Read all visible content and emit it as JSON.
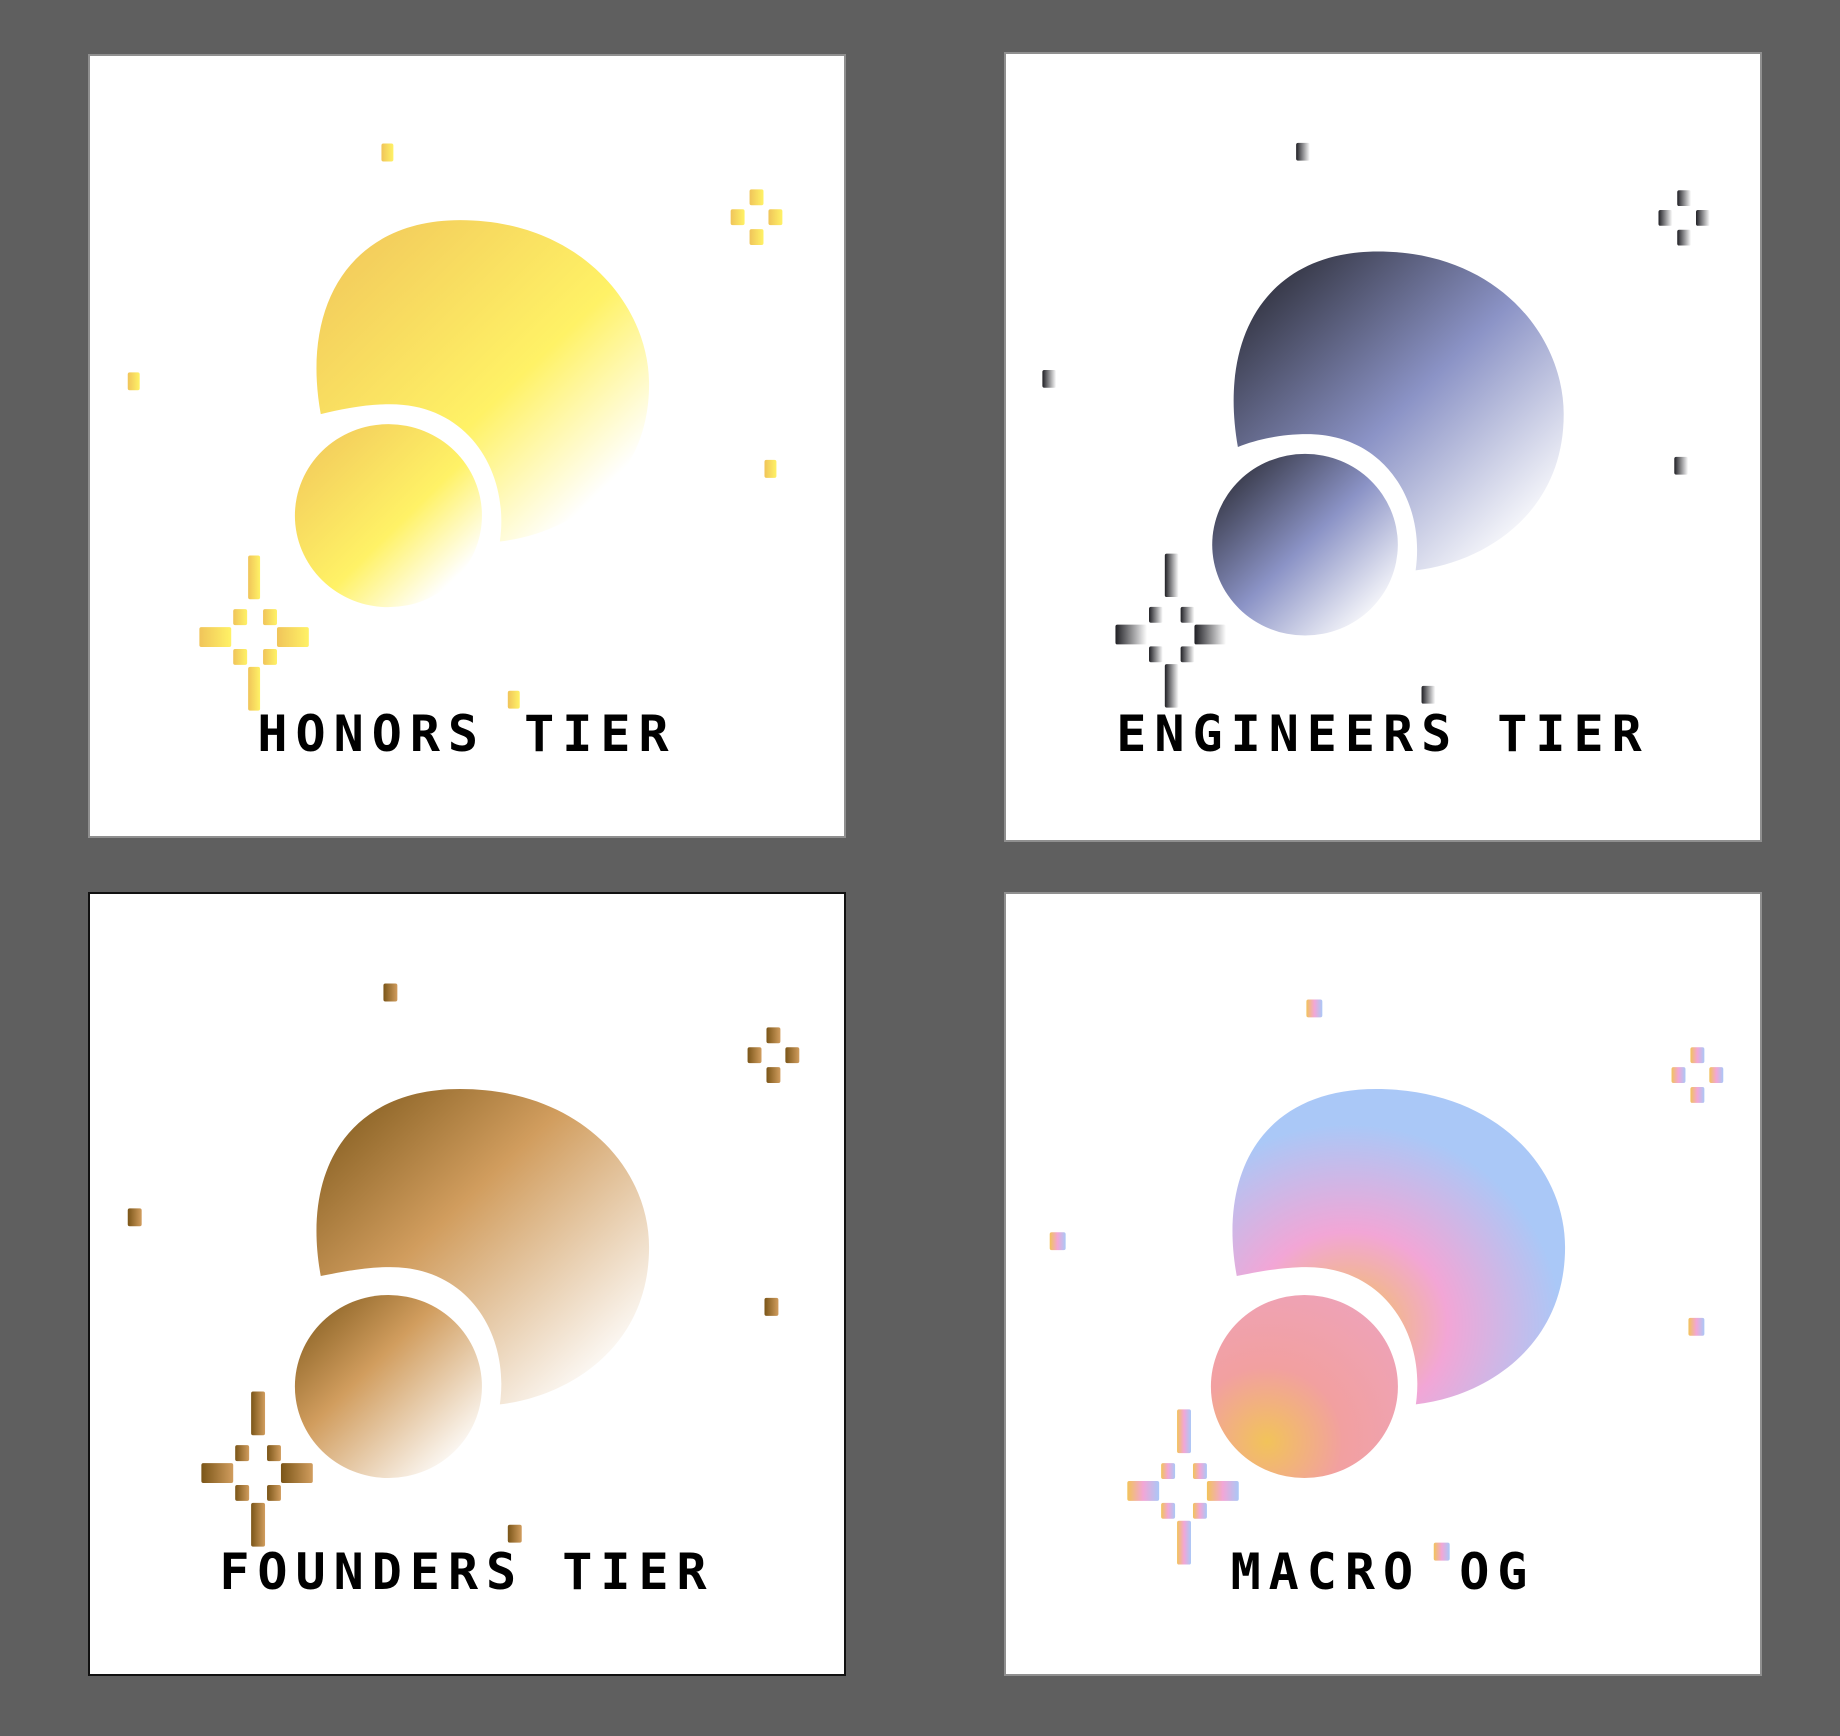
{
  "cards": [
    {
      "id": "honors",
      "title": "HONORS TIER",
      "colors": {
        "c1": "#f0c45a",
        "c2": "#fff266",
        "c3": "#ffffff"
      }
    },
    {
      "id": "engineers",
      "title": "ENGINEERS TIER",
      "colors": {
        "c1": "#1f1f24",
        "c2": "#8b93c6",
        "c3": "#ffffff"
      }
    },
    {
      "id": "founders",
      "title": "FOUNDERS TIER",
      "colors": {
        "c1": "#7a5518",
        "c2": "#d19d5e",
        "c3": "#ffffff"
      }
    },
    {
      "id": "macro",
      "title": "MACRO OG",
      "colors": {
        "c1": "#f2c35a",
        "c2": "#f2a6d6",
        "c3": "#aac8f7"
      }
    }
  ]
}
